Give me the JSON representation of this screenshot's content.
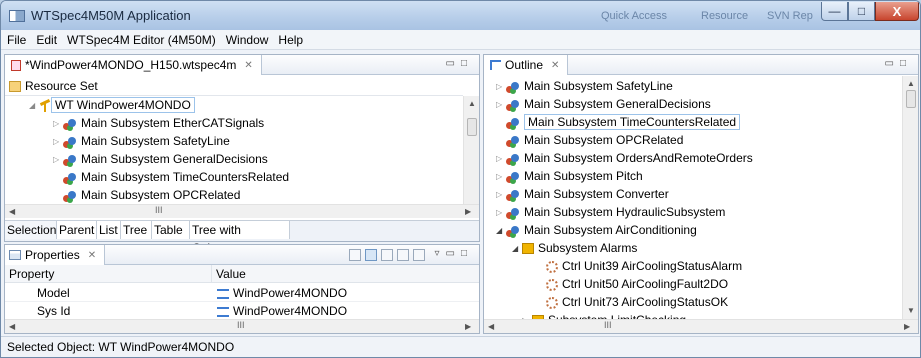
{
  "window": {
    "title": "WTSpec4M50M Application",
    "faded_title_bar_text": [
      "Quick Access",
      "Resource",
      "SVN Rep"
    ],
    "controls": {
      "minimize": "—",
      "maximize": "□",
      "close": "X"
    }
  },
  "menu": [
    "File",
    "Edit",
    "WTSpec4M Editor (4M50M)",
    "Window",
    "Help"
  ],
  "editor": {
    "tab_label": "*WindPower4MONDO_H150.wtspec4m",
    "tab_close": "✕",
    "resource_set_label": "Resource Set",
    "tree": [
      {
        "label": "WT WindPower4MONDO",
        "icon": "wind-turbine-icon",
        "expanded": true,
        "selected": true
      },
      {
        "label": "Main Subsystem EtherCATSignals",
        "icon": "subsystem-icon",
        "expandable": true
      },
      {
        "label": "Main Subsystem SafetyLine",
        "icon": "subsystem-icon",
        "expandable": true
      },
      {
        "label": "Main Subsystem GeneralDecisions",
        "icon": "subsystem-icon",
        "expandable": true
      },
      {
        "label": "Main Subsystem TimeCountersRelated",
        "icon": "subsystem-icon",
        "expandable": false
      },
      {
        "label": "Main Subsystem OPCRelated",
        "icon": "subsystem-icon",
        "expandable": false
      }
    ],
    "hscroll_grip": "III",
    "bottom_tabs": [
      "Selection",
      "Parent",
      "List",
      "Tree",
      "Table",
      "Tree with Columns"
    ]
  },
  "properties": {
    "tab_label": "Properties",
    "tab_close": "✕",
    "columns": [
      "Property",
      "Value"
    ],
    "rows": [
      {
        "property": "Model",
        "value": "WindPower4MONDO"
      },
      {
        "property": "Sys Id",
        "value": "WindPower4MONDO"
      }
    ],
    "hscroll_grip": "III"
  },
  "outline": {
    "tab_label": "Outline",
    "tab_close": "✕",
    "tree": [
      {
        "label": "Main Subsystem SafetyLine",
        "icon": "subsystem-icon",
        "level": 0,
        "expander": "collapsed"
      },
      {
        "label": "Main Subsystem GeneralDecisions",
        "icon": "subsystem-icon",
        "level": 0,
        "expander": "collapsed"
      },
      {
        "label": "Main Subsystem TimeCountersRelated",
        "icon": "subsystem-icon",
        "level": 0,
        "expander": "none",
        "selected": true
      },
      {
        "label": "Main Subsystem OPCRelated",
        "icon": "subsystem-icon",
        "level": 0,
        "expander": "none"
      },
      {
        "label": "Main Subsystem OrdersAndRemoteOrders",
        "icon": "subsystem-icon",
        "level": 0,
        "expander": "collapsed"
      },
      {
        "label": "Main Subsystem Pitch",
        "icon": "subsystem-icon",
        "level": 0,
        "expander": "collapsed"
      },
      {
        "label": "Main Subsystem Converter",
        "icon": "subsystem-icon",
        "level": 0,
        "expander": "collapsed"
      },
      {
        "label": "Main Subsystem HydraulicSubsystem",
        "icon": "subsystem-icon",
        "level": 0,
        "expander": "collapsed"
      },
      {
        "label": "Main Subsystem AirConditioning",
        "icon": "subsystem-icon",
        "level": 0,
        "expander": "expanded"
      },
      {
        "label": "Subsystem Alarms",
        "icon": "folder-icon",
        "level": 1,
        "expander": "expanded"
      },
      {
        "label": "Ctrl Unit39 AirCoolingStatusAlarm",
        "icon": "control-unit-icon",
        "level": 2,
        "expander": "none"
      },
      {
        "label": "Ctrl Unit50 AirCoolingFault2DO",
        "icon": "control-unit-icon",
        "level": 2,
        "expander": "none"
      },
      {
        "label": "Ctrl Unit73 AirCoolingStatusOK",
        "icon": "control-unit-icon",
        "level": 2,
        "expander": "none"
      },
      {
        "label": "Subsystem LimitChecking",
        "icon": "folder-icon",
        "level": 1,
        "expander": "collapsed"
      }
    ],
    "hscroll_grip": "III"
  },
  "status": {
    "text": "Selected Object: WT WindPower4MONDO"
  },
  "colors": {
    "title_bar": "#b6cde9",
    "selection_border": "#9cc3ea",
    "close_button": "#c8452e"
  }
}
